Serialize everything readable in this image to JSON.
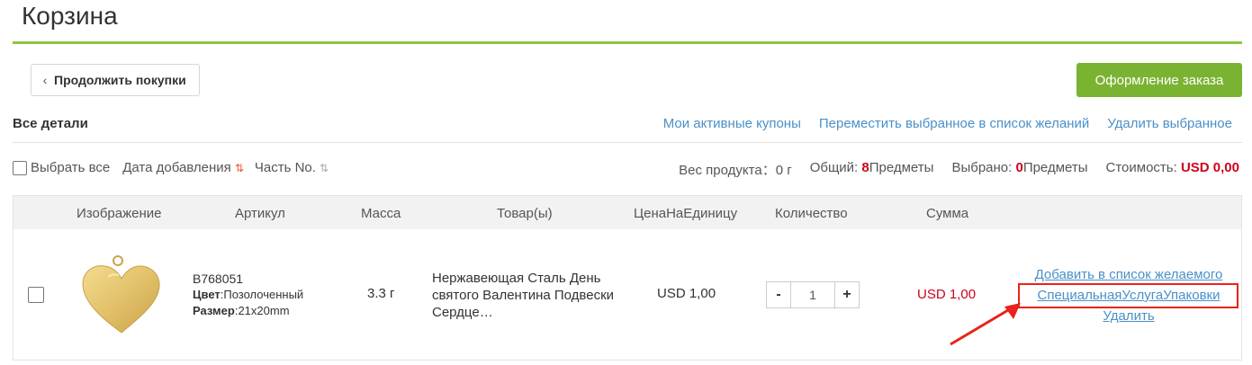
{
  "page": {
    "title": "Корзина"
  },
  "buttons": {
    "continue": "Продолжить покупки",
    "checkout": "Оформление заказа"
  },
  "section": {
    "all_details": "Все детали"
  },
  "top_links": [
    "Мои активные купоны",
    "Переместить выбранное в список желаний",
    "Удалить выбранное"
  ],
  "toolbar": {
    "select_all": "Выбрать все",
    "sort_date": "Дата добавления",
    "sort_part": "Часть No.",
    "weight_label": "Вес продукта：",
    "weight_value": "0 г",
    "total_label": "Общий:",
    "total_count": "8",
    "total_unit": "Предметы",
    "selected_label": "Выбрано:",
    "selected_count": "0",
    "selected_unit": "Предметы",
    "cost_label": "Стоимость:",
    "cost_value": "USD 0,00"
  },
  "table": {
    "headers": [
      "Изображение",
      "Артикул",
      "Масса",
      "Товар(ы)",
      "ЦенаНаЕдиницу",
      "Количество",
      "Сумма"
    ],
    "rows": [
      {
        "sku": "B768051",
        "color_label": "Цвет",
        "color_value": ":Позолоченный",
        "size_label": "Размер",
        "size_value": ":21x20mm",
        "mass": "3.3 г",
        "product": "Нержавеющая Сталь День святого Валентина Подвески Сердце…",
        "unit_price": "USD 1,00",
        "qty_minus": "-",
        "qty": "1",
        "qty_plus": "+",
        "sum": "USD 1,00",
        "actions": [
          "Добавить в список желаемого",
          "СпециальнаяУслугаУпаковки",
          "Удалить"
        ]
      }
    ]
  },
  "colors": {
    "accent_green": "#7ab332",
    "rule_green": "#8dc63f",
    "link_blue": "#4a90c8",
    "price_red": "#d0021b",
    "annotation_red": "#e8231b"
  },
  "icons": [
    "chevron-left-icon",
    "sort-arrows-icon",
    "product-thumbnail",
    "annotation-arrow"
  ]
}
